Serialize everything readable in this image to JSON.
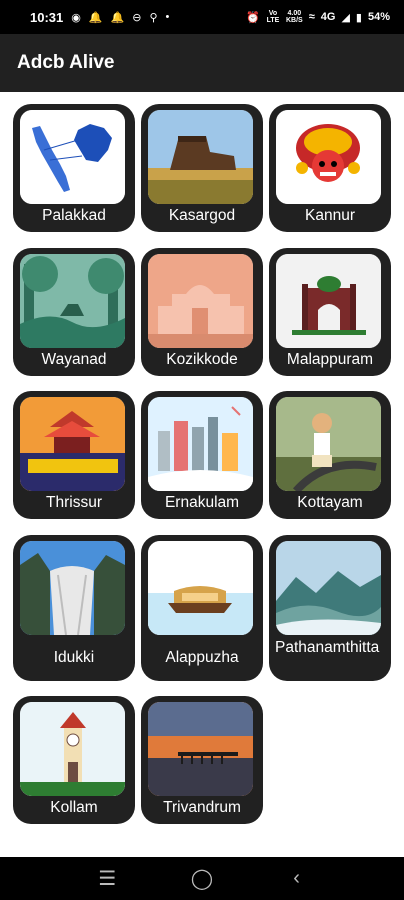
{
  "status_bar": {
    "time": "10:31",
    "left_icons": [
      "chat-icon",
      "bell-icon",
      "bell-icon",
      "vpn-icon",
      "location-icon",
      "dot-icon"
    ],
    "right_icons": [
      "alarm-icon",
      "volte-icon",
      "data-speed-icon",
      "wifi-icon",
      "signal-icon",
      "battery-icon"
    ],
    "volte_text": "Vo LTE",
    "speed_value": "4.00",
    "speed_unit": "KB/S",
    "network": "4G",
    "battery": "54%"
  },
  "app_bar": {
    "title": "Adcb Alive"
  },
  "districts": [
    {
      "label": "Palakkad",
      "icon": "kerala-map-image"
    },
    {
      "label": "Kasargod",
      "icon": "fort-image"
    },
    {
      "label": "Kannur",
      "icon": "theyyam-image"
    },
    {
      "label": "Wayanad",
      "icon": "forest-image"
    },
    {
      "label": "Kozikkode",
      "icon": "palace-image"
    },
    {
      "label": "Malappuram",
      "icon": "gateway-image"
    },
    {
      "label": "Thrissur",
      "icon": "temple-festival-image"
    },
    {
      "label": "Ernakulam",
      "icon": "city-skyline-image"
    },
    {
      "label": "Kottayam",
      "icon": "rubber-farmer-image"
    },
    {
      "label": "Idukki",
      "icon": "dam-image"
    },
    {
      "label": "Alappuzha",
      "icon": "houseboat-image"
    },
    {
      "label": "Pathanamthitta",
      "icon": "misty-hills-image"
    },
    {
      "label": "Kollam",
      "icon": "clock-tower-image"
    },
    {
      "label": "Trivandrum",
      "icon": "pier-sunset-image"
    }
  ],
  "nav_bar": {
    "recents_icon": "recents-icon",
    "home_icon": "home-icon",
    "back_icon": "back-icon"
  }
}
